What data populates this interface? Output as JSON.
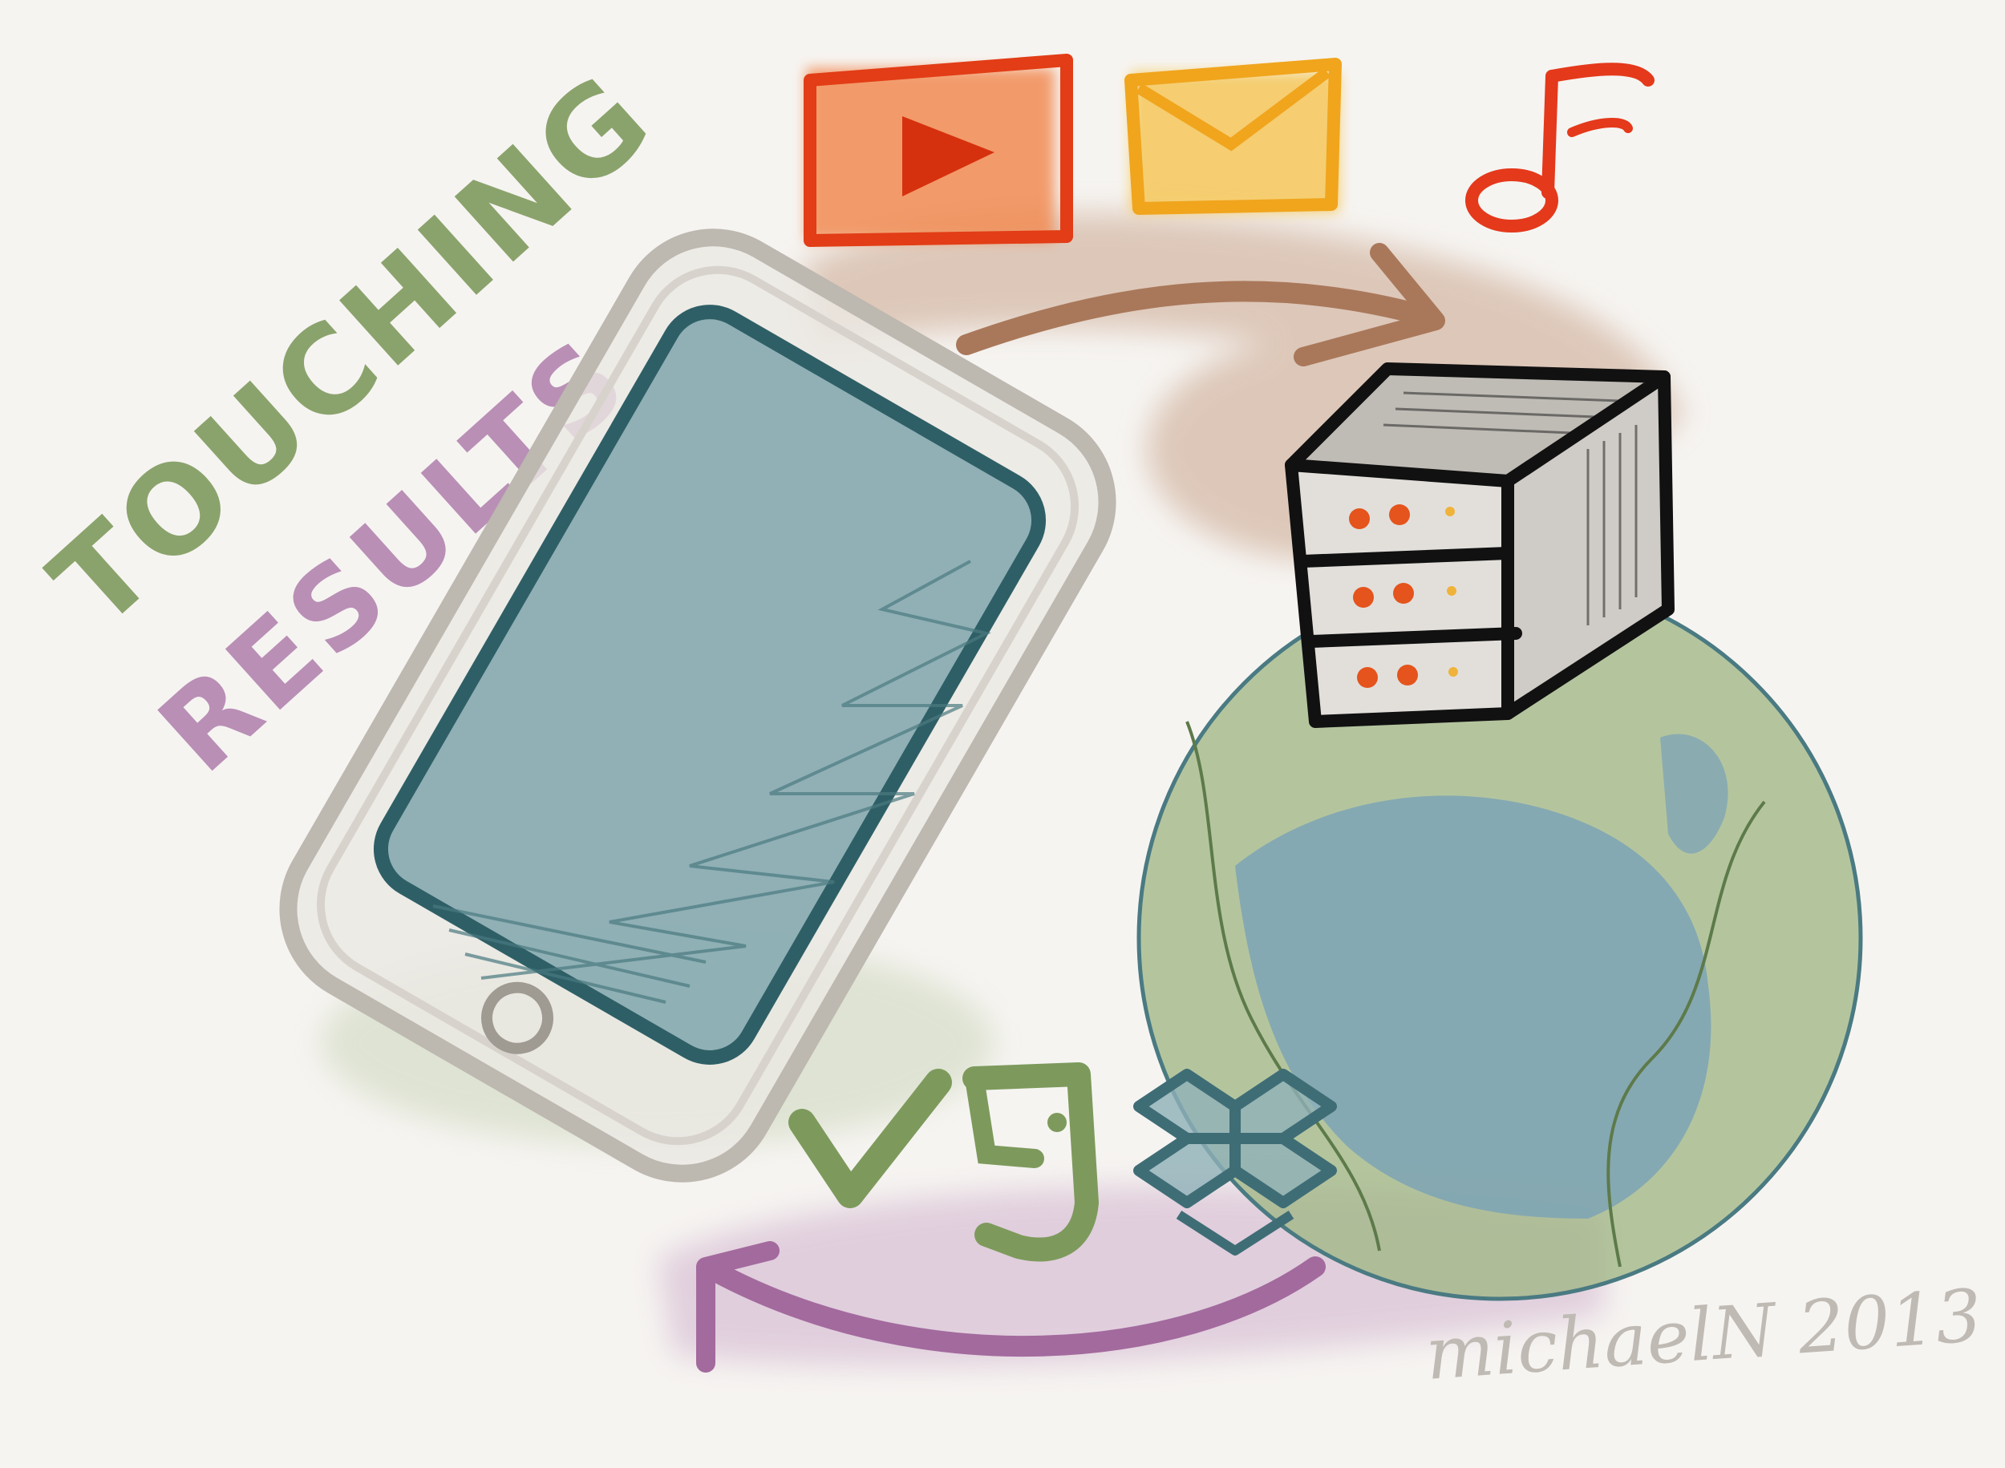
{
  "title_lines": [
    "TOUCHING",
    "RESULTS"
  ],
  "signature": "michaelN 2013",
  "colors": {
    "background": "#f6f4f1",
    "title_green": "#8aa36c",
    "title_purple": "#b98fb6",
    "tablet_frame": "#bdb8b0",
    "tablet_screen": "#7fa6ad",
    "tablet_screen_outline": "#2f5f66",
    "video_orange": "#ef6a2d",
    "mail_yellow": "#f2b32a",
    "music_red": "#e4391b",
    "arrow_brown": "#a9785a",
    "arrow_purple": "#a36a9e",
    "globe_green": "#9db582",
    "globe_blue": "#7fa5b4",
    "server_outline": "#111111",
    "server_led": "#e4541c",
    "icon_green": "#7d9a5c",
    "dropbox_teal": "#4f7f88",
    "signature_gray": "#bfbab3"
  },
  "icons": [
    "tablet-icon",
    "video-play-icon",
    "mail-envelope-icon",
    "music-note-icon",
    "server-icon",
    "globe-icon",
    "checkmark-icon",
    "evernote-icon",
    "dropbox-icon",
    "sync-arrow-brown-icon",
    "sync-arrow-purple-icon"
  ]
}
